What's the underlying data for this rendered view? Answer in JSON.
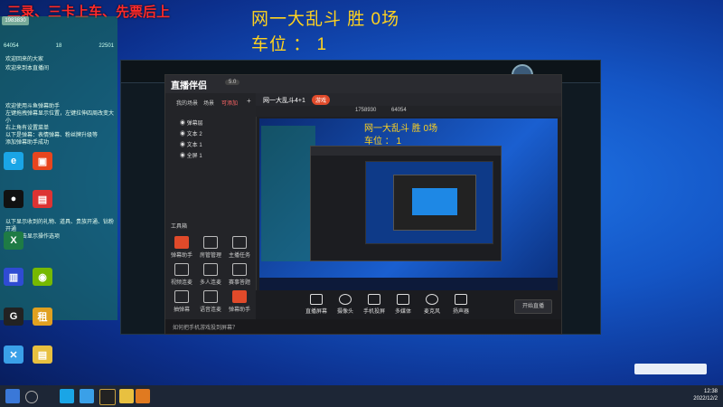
{
  "overlay": {
    "banner": "三录、三卡上车、先票后上",
    "stat_line1": "网一大乱斗 胜 0场",
    "stat_line2": "车位 ： 1"
  },
  "chat_panel": {
    "badge": "1983830",
    "stats": [
      "64054",
      "18",
      "22501"
    ],
    "lines": [
      "欢迎回来的大家",
      "欢迎来到本直播间",
      "欢迎使用斗鱼弹幕助手",
      "左键拖拽弹幕显示位置，左键拉伸四周改变大小",
      "右上角有设置菜单",
      "以下是弹幕：表情弹幕、粉丝牌升级等",
      "添加弹幕助手成功",
      "以下显示收到的礼物、道具、贵族开通、钻粉开通",
      "右键单击显示操作选项"
    ]
  },
  "desktop_icons": [
    {
      "label": "",
      "icon": "edge-icon",
      "color": "#1aa5e6"
    },
    {
      "label": "",
      "icon": "tencent-icon",
      "color": "#e8451e"
    },
    {
      "label": "",
      "icon": "qq-icon",
      "color": "#111"
    },
    {
      "label": "",
      "icon": "red-app-icon",
      "color": "#d33"
    },
    {
      "label": "",
      "icon": "excel-icon",
      "color": "#1e7b45"
    },
    {
      "label": "",
      "icon": "nvidia-icon",
      "color": "#76b900"
    },
    {
      "label": "",
      "icon": "app-icon",
      "color": "#2f4bd3"
    },
    {
      "label": "",
      "icon": "app-icon",
      "color": "#444"
    },
    {
      "label": "",
      "icon": "game-icon",
      "color": "#222"
    },
    {
      "label": "",
      "icon": "game-icon",
      "color": "#e0a020"
    },
    {
      "label": "",
      "icon": "xbox-icon",
      "color": "#3aa0e8"
    },
    {
      "label": "",
      "icon": "file-icon",
      "color": "#e8c040"
    }
  ],
  "studio": {
    "logo": "直播伴侣",
    "version": "5.0",
    "tabs": [
      "我的场景",
      "场景",
      "可添加"
    ],
    "layers": [
      "弹幕层",
      "文本 2",
      "文本 1",
      "全屏 1"
    ],
    "room_title": "网一大乱斗4+1",
    "category": "游戏",
    "room_info": "1758930",
    "viewers": "64054",
    "tool_section": "工具箱",
    "tools": [
      {
        "label": "弹幕助手",
        "red": true
      },
      {
        "label": "房管管理",
        "red": false
      },
      {
        "label": "主播任务",
        "red": false
      },
      {
        "label": "视频连麦",
        "red": false
      },
      {
        "label": "多人连麦",
        "red": false
      },
      {
        "label": "赛事答题",
        "red": false
      },
      {
        "label": "抽弹幕",
        "red": false
      },
      {
        "label": "语音连麦",
        "red": false
      },
      {
        "label": "弹幕助手",
        "red": true
      }
    ],
    "bottom_buttons": [
      "直播屏幕",
      "摄像头",
      "手机投屏",
      "多媒体",
      "麦克风",
      "扬声器"
    ],
    "start_button": "开始直播",
    "status_text": "如何把手机游戏投到屏幕？",
    "preview_stat1": "网一大乱斗 胜 0场",
    "preview_stat2": "车位 ： 1"
  },
  "taskbar": {
    "time": "12:38",
    "date": "2022/12/2"
  },
  "colors": {
    "accent_red": "#ff2a2a",
    "stat_yellow": "#ffd21f",
    "desktop_blue": "#1456c6"
  }
}
